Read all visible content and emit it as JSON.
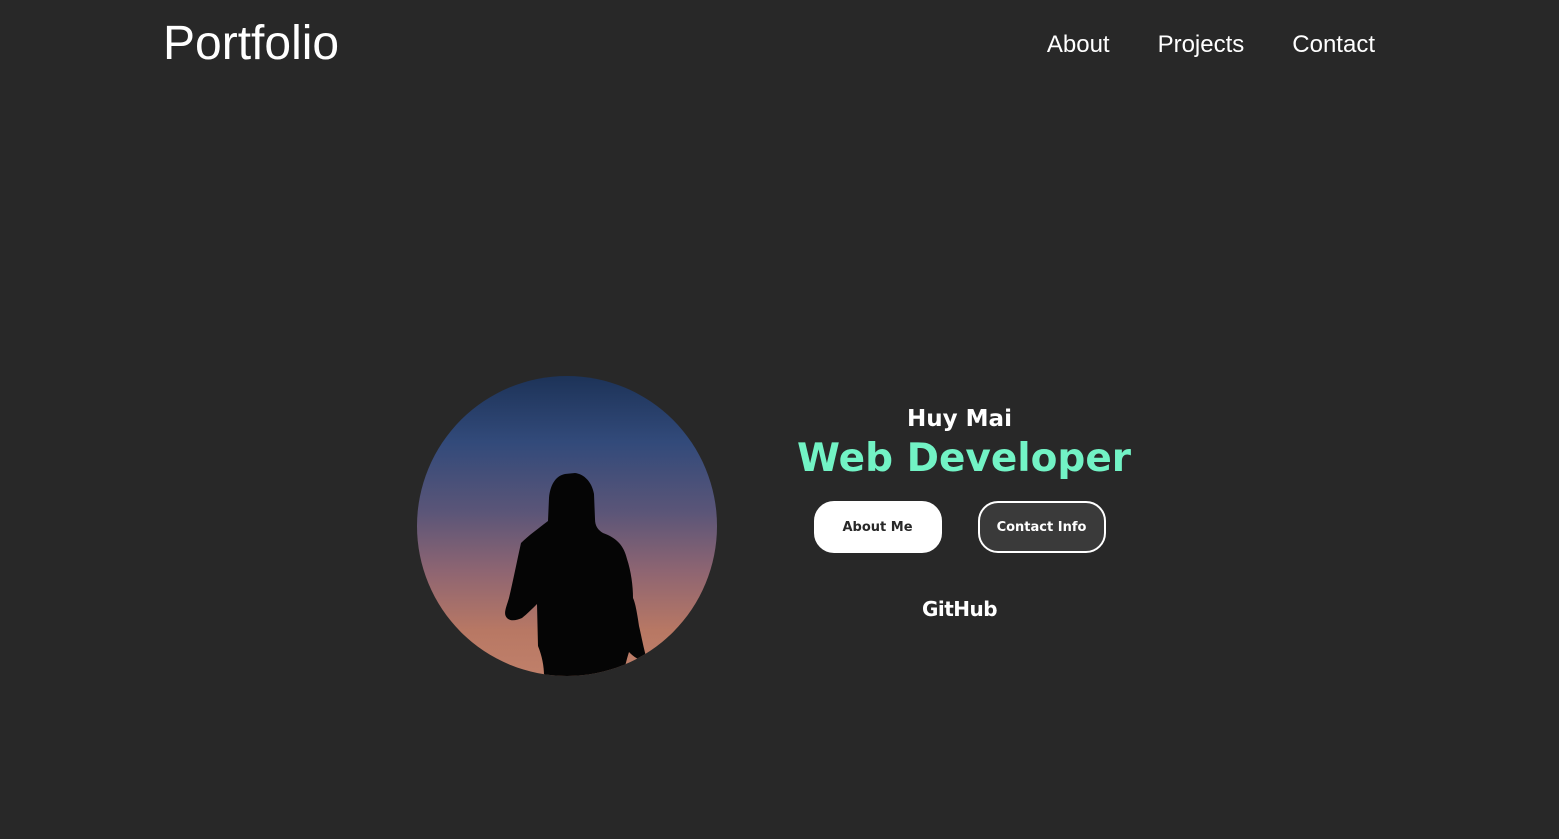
{
  "header": {
    "logo": "Portfolio",
    "nav": [
      "About",
      "Projects",
      "Contact"
    ]
  },
  "hero": {
    "name": "Huy Mai",
    "title": "Web Developer",
    "buttons": {
      "primary": "About Me",
      "secondary": "Contact Info"
    },
    "github_link": "GitHub"
  },
  "colors": {
    "background": "#282828",
    "accent": "#72f3c5",
    "text": "#ffffff"
  },
  "icons": {
    "avatar": "profile-silhouette-image"
  }
}
